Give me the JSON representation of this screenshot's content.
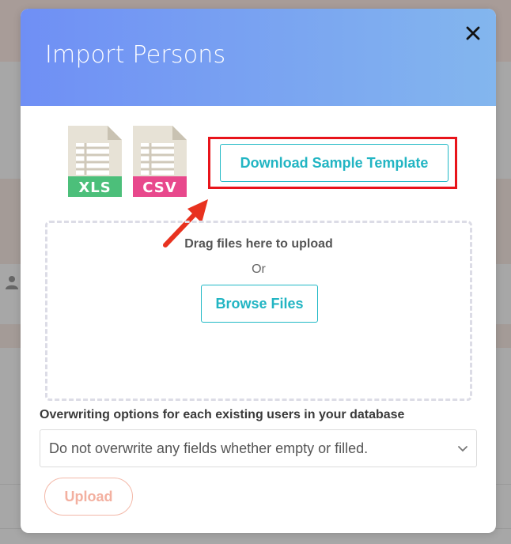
{
  "modal": {
    "title": "Import Persons",
    "close_icon": "close-icon"
  },
  "file_types": [
    {
      "label": "XLS",
      "color": "#4cbf7a"
    },
    {
      "label": "CSV",
      "color": "#e8488c"
    }
  ],
  "download_button": {
    "label": "Download Sample Template"
  },
  "dropzone": {
    "instructions": "Drag files here to upload",
    "or_text": "Or",
    "browse_label": "Browse Files"
  },
  "overwrite": {
    "label": "Overwriting options for each existing users in your database",
    "selected": "Do not overwrite any fields whether empty or filled."
  },
  "upload_button": {
    "label": "Upload"
  },
  "colors": {
    "header_gradient_start": "#6f8ff5",
    "header_gradient_end": "#83b6ee",
    "accent": "#22b5c3",
    "highlight": "#e8141b",
    "upload_disabled": "#f3b0a0"
  }
}
